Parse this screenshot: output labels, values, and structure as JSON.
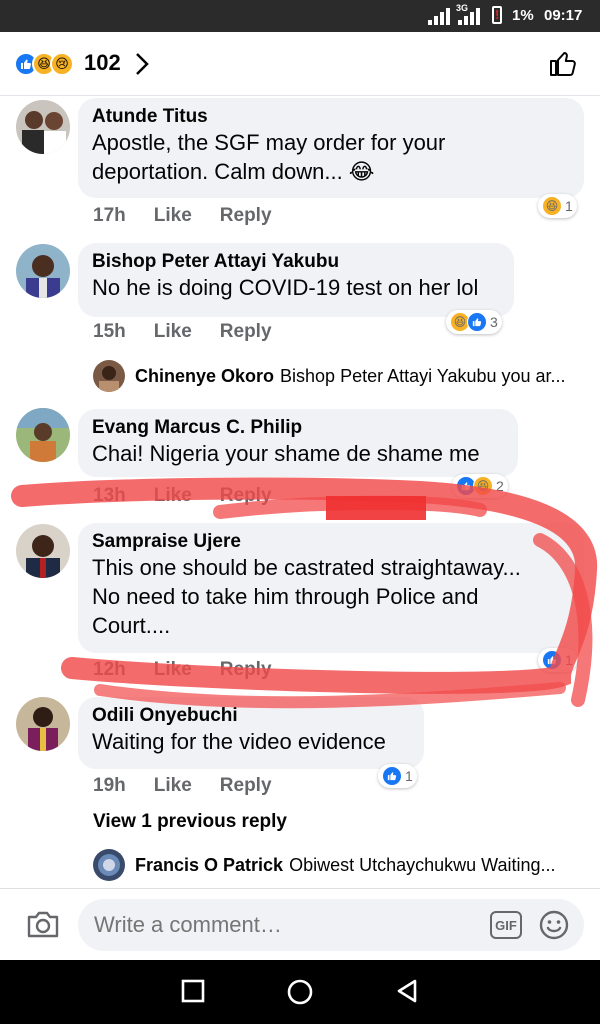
{
  "status_bar": {
    "network_label": "3G",
    "battery": "1%",
    "time": "09:17",
    "battery_alert": "!"
  },
  "header": {
    "reaction_icons": [
      "like-icon",
      "haha-icon",
      "sad-icon"
    ],
    "reaction_count": "102"
  },
  "comments": [
    {
      "author": "Atunde Titus",
      "text_lines": [
        "Apostle, the SGF may order for your",
        "deportation. Calm down... 😂"
      ],
      "time": "17h",
      "like": "Like",
      "reply": "Reply",
      "reaction_count": "1"
    },
    {
      "author": "Bishop Peter Attayi Yakubu",
      "text_lines": [
        "No he is doing COVID-19 test on her lol"
      ],
      "time": "15h",
      "like": "Like",
      "reply": "Reply",
      "reaction_count": "3",
      "reply_preview": {
        "author": "Chinenye Okoro",
        "text": "Bishop Peter Attayi Yakubu you ar..."
      }
    },
    {
      "author": "Evang Marcus C. Philip",
      "text_lines": [
        "Chai! Nigeria your shame de shame me"
      ],
      "time": "13h",
      "like": "Like",
      "reply": "Reply",
      "reaction_count": "2"
    },
    {
      "author": "Sampraise Ujere",
      "text_lines": [
        "This one should be castrated straightaway...",
        "No need to take him through Police and",
        "Court...."
      ],
      "time": "12h",
      "like": "Like",
      "reply": "Reply",
      "reaction_count": "1"
    },
    {
      "author": "Odili Onyebuchi",
      "text_lines": [
        "Waiting for the video evidence"
      ],
      "time": "19h",
      "like": "Like",
      "reply": "Reply",
      "reaction_count": "1",
      "view_previous": "View 1 previous reply",
      "reply_preview": {
        "author": "Francis O Patrick",
        "text": "Obiwest Utchaychukwu Waiting..."
      }
    }
  ],
  "composer": {
    "placeholder": "Write a comment…",
    "gif_label": "GIF"
  },
  "colors": {
    "facebook_blue": "#1877f2",
    "bubble_bg": "#f0f2f5",
    "meta_gray": "#65676b",
    "annotation_red": "#f24a4a"
  }
}
